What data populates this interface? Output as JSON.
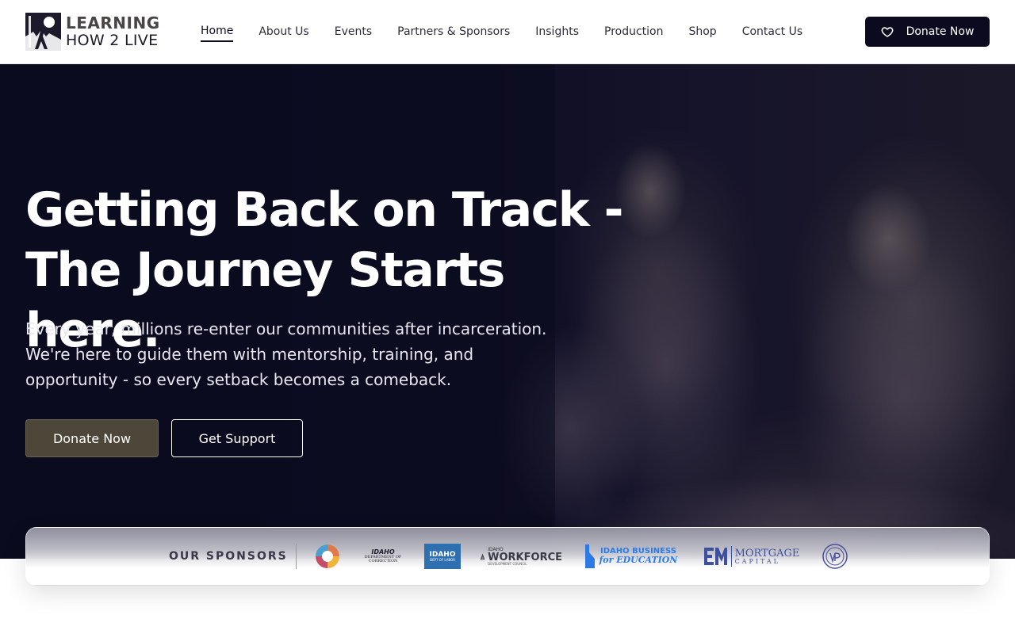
{
  "header": {
    "logo": {
      "line1": "LEARNING",
      "line2": "HOW 2 LIVE",
      "icon": "logo-figure-icon"
    },
    "nav": [
      {
        "label": "Home",
        "active": true
      },
      {
        "label": "About Us",
        "active": false
      },
      {
        "label": "Events",
        "active": false
      },
      {
        "label": "Partners & Sponsors",
        "active": false
      },
      {
        "label": "Insights",
        "active": false
      },
      {
        "label": "Production",
        "active": false
      },
      {
        "label": "Shop",
        "active": false
      },
      {
        "label": "Contact Us",
        "active": false
      }
    ],
    "donate": {
      "label": "Donate Now",
      "icon": "heart-icon"
    }
  },
  "hero": {
    "title_line1": "Getting Back on Track -",
    "title_line2": "The Journey Starts here.",
    "subtitle": "Every year, millions re-enter our communities after incarceration. We're here to guide them with mentorship, training, and opportunity - so every setback becomes a comeback.",
    "primary_button": "Donate Now",
    "secondary_button": "Get Support"
  },
  "sponsors": {
    "label": "OUR SPONSORS",
    "logos": [
      {
        "name": "circle-emblem-logo"
      },
      {
        "name": "idaho-department-of-correction-logo",
        "text1": "IDAHO",
        "text2": "DEPARTMENT OF",
        "text3": "CORRECTION"
      },
      {
        "name": "idaho-department-of-labor-logo",
        "text1": "IDAHO",
        "text2": "DEPT OF LABOR"
      },
      {
        "name": "idaho-workforce-development-council-logo",
        "text1": "IDAHO",
        "text2": "WORKFORCE",
        "text3": "DEVELOPMENT COUNCIL"
      },
      {
        "name": "idaho-business-for-education-logo",
        "text1": "IDAHO BUSINESS",
        "text2": "for EDUCATION"
      },
      {
        "name": "mortgage-capital-logo",
        "text1": "MORTGAGE",
        "text2": "CAPITAL"
      },
      {
        "name": "seal-logo"
      }
    ]
  },
  "colors": {
    "navy": "#0b0a1f",
    "primary_button": "#4e4739",
    "white": "#ffffff"
  }
}
